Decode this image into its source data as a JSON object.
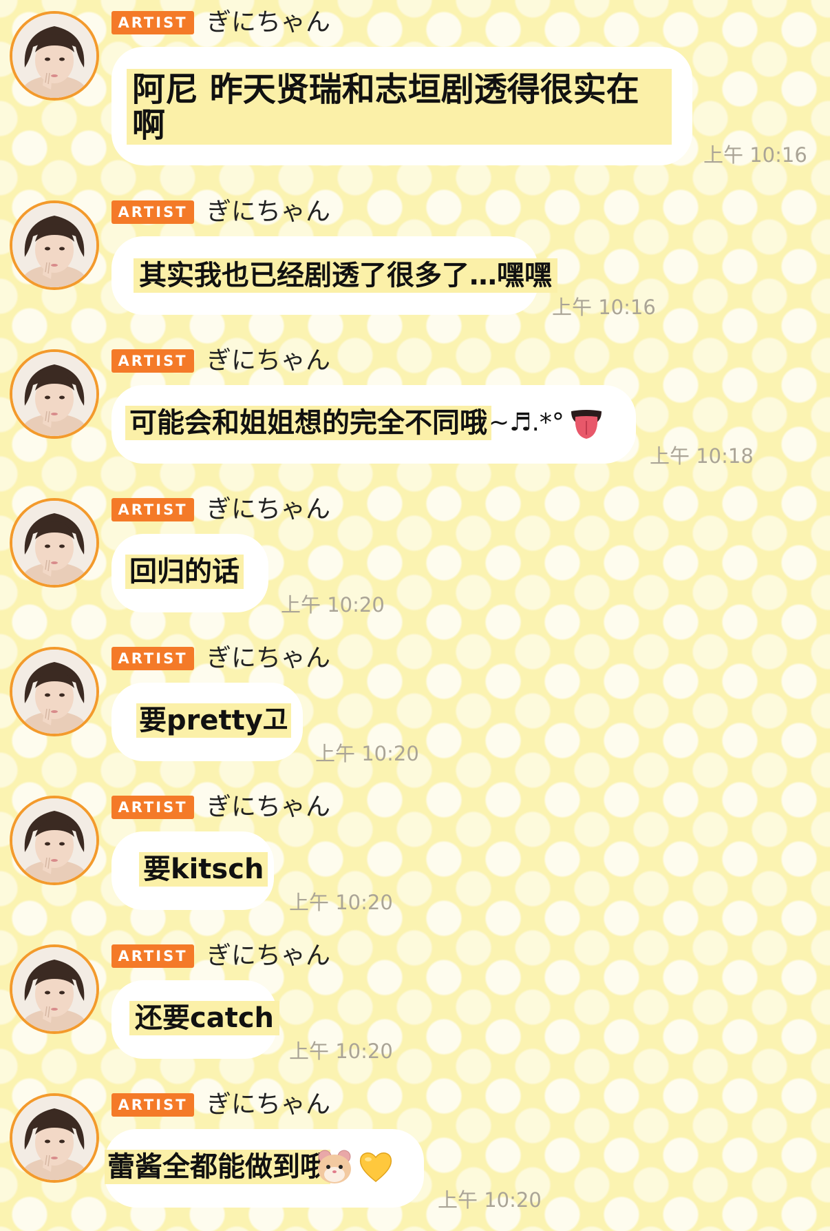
{
  "sender": {
    "badge": "ARTIST",
    "name": "ぎにちゃん"
  },
  "messages": [
    {
      "text_line1": "阿尼 昨天贤瑞和志垣剧透得很实在",
      "text_line2": "啊",
      "time": "上午 10:16"
    },
    {
      "text": "其实我也已经剧透了很多了…嘿嘿",
      "time": "上午 10:16"
    },
    {
      "text": "可能会和姐姐想的完全不同哦",
      "suffix": "~♬.*°",
      "emoji": "tongue-face",
      "time": "上午 10:18"
    },
    {
      "text": "回归的话",
      "time": "上午 10:20"
    },
    {
      "text": "要pretty고",
      "time": "上午 10:20"
    },
    {
      "text": "要kitsch",
      "time": "上午 10:20"
    },
    {
      "text": "还要catch",
      "time": "上午 10:20"
    },
    {
      "text": "蕾酱全都能做到哦",
      "emoji_1": "hamster-face",
      "emoji_2": "yellow-heart",
      "time": "上午 10:20"
    }
  ],
  "colors": {
    "background": "#fbf3b1",
    "badge": "#f47a28",
    "avatar_ring": "#f39a2c",
    "bubble": "#ffffff",
    "highlight": "#fbf0a8",
    "timestamp": "#aaa496"
  }
}
